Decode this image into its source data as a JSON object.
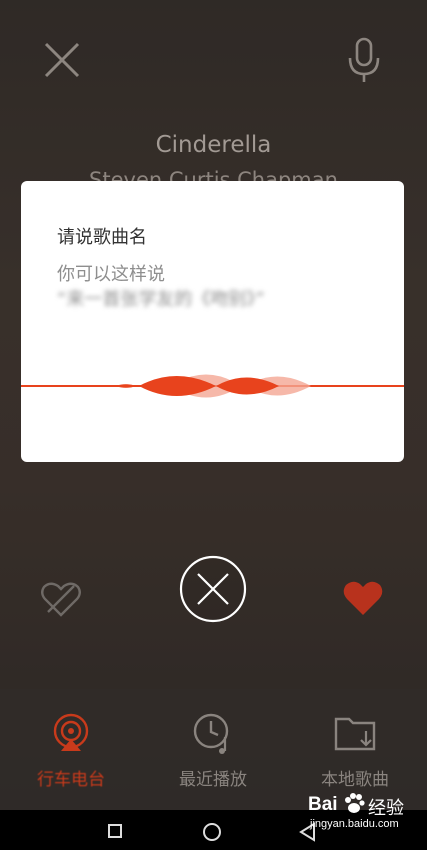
{
  "player": {
    "title": "Cinderella",
    "artist": "Steven Curtis Chapman"
  },
  "dialog": {
    "title": "请说歌曲名",
    "hint_line1": "你可以这样说",
    "hint_line2": "“来一首张学友的《吻别》”"
  },
  "bottom_nav": {
    "items": [
      {
        "label": "行车电台",
        "icon": "radio-icon",
        "active": true
      },
      {
        "label": "最近播放",
        "icon": "clock-music-icon",
        "active": false
      },
      {
        "label": "本地歌曲",
        "icon": "folder-download-icon",
        "active": false
      }
    ]
  },
  "watermark": {
    "brand": "Bai",
    "brand_tail": "经验",
    "url": "jingyan.baidu.com"
  },
  "colors": {
    "accent": "#e8431d",
    "heart": "#b8321d"
  }
}
